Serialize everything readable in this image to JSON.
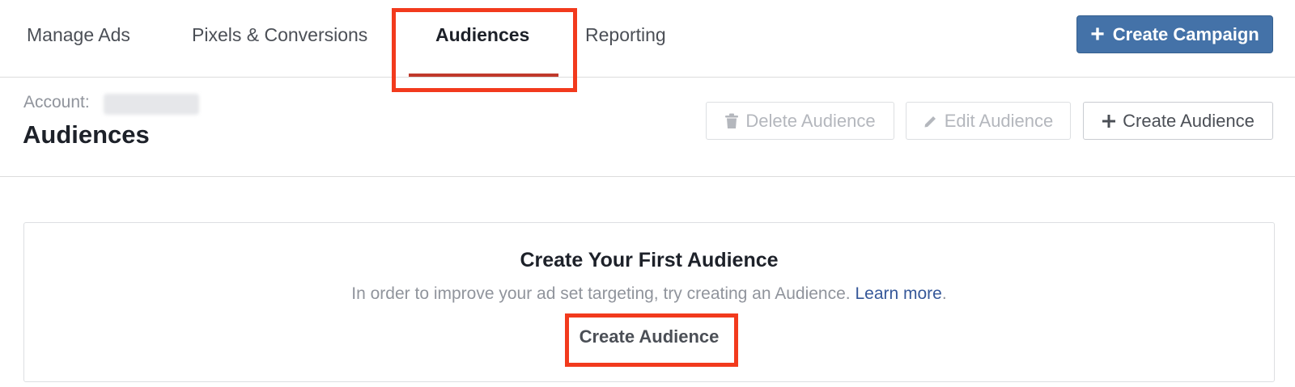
{
  "nav": {
    "tabs": [
      {
        "label": "Manage Ads",
        "active": false
      },
      {
        "label": "Pixels & Conversions",
        "active": false
      },
      {
        "label": "Audiences",
        "active": true
      },
      {
        "label": "Reporting",
        "active": false
      }
    ],
    "create_campaign_label": "Create Campaign"
  },
  "header": {
    "account_label": "Account:",
    "title": "Audiences",
    "actions": {
      "delete_label": "Delete Audience",
      "edit_label": "Edit Audience",
      "create_label": "Create Audience"
    }
  },
  "empty_state": {
    "title": "Create Your First Audience",
    "description": "In order to improve your ad set targeting, try creating an Audience.",
    "link_label": "Learn more",
    "description_end": ".",
    "cta_label": "Create Audience"
  },
  "colors": {
    "primary": "#4472a8",
    "annotation": "#f23a1d",
    "active_underline": "#c0392b",
    "link": "#365899"
  },
  "icons": {
    "delete": "trash-icon",
    "edit": "pencil-icon",
    "create": "plus-icon"
  }
}
